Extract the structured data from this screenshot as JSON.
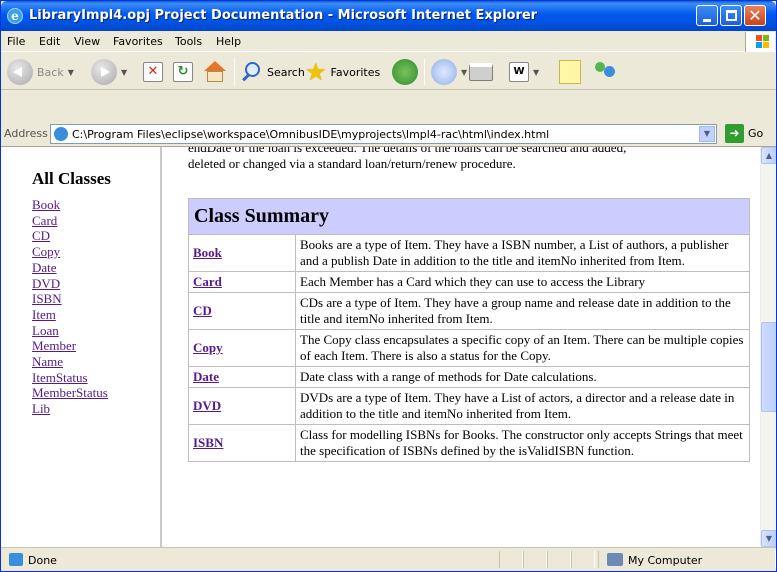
{
  "window": {
    "title": "LibraryImpl4.opj Project Documentation - Microsoft Internet Explorer"
  },
  "menu": [
    "File",
    "Edit",
    "View",
    "Favorites",
    "Tools",
    "Help"
  ],
  "toolbar": {
    "back_label": "Back",
    "search_label": "Search",
    "favorites_label": "Favorites"
  },
  "address": {
    "label": "Address",
    "url": "C:\\Program Files\\eclipse\\workspace\\OmnibusIDE\\myprojects\\Impl4-rac\\html\\index.html",
    "go_label": "Go"
  },
  "sidebar": {
    "heading": "All Classes",
    "classes": [
      "Book",
      "Card",
      "CD",
      "Copy",
      "Date",
      "DVD",
      "ISBN",
      "Item",
      "Loan",
      "Member",
      "Name",
      "ItemStatus",
      "MemberStatus",
      "Lib"
    ]
  },
  "main": {
    "intro_cut": "endDate of the loan is exceeded. The details of the loans can be searched and added,",
    "intro": "deleted or changed via a standard loan/return/renew procedure.",
    "summary_heading": "Class Summary",
    "rows": [
      {
        "name": "Book",
        "desc": "Books are a type of Item. They have a ISBN number, a List of authors, a publisher and a publish Date in addition to the title and itemNo inherited from Item."
      },
      {
        "name": "Card",
        "desc": "Each Member has a Card which they can use to access the Library"
      },
      {
        "name": "CD",
        "desc": "CDs are a type of Item. They have a group name and release date in addition to the title and itemNo inherited from Item."
      },
      {
        "name": "Copy",
        "desc": "The Copy class encapsulates a specific copy of an Item. There can be multiple copies of each Item. There is also a status for the Copy."
      },
      {
        "name": "Date",
        "desc": "Date class with a range of methods for Date calculations."
      },
      {
        "name": "DVD",
        "desc": "DVDs are a type of Item. They have a List of actors, a director and a release date in addition to the title and itemNo inherited from Item."
      },
      {
        "name": "ISBN",
        "desc": "Class for modelling ISBNs for Books. The constructor only accepts Strings that meet the specification of ISBNs defined by the isValidISBN function."
      }
    ]
  },
  "status": {
    "text": "Done",
    "zone": "My Computer"
  }
}
